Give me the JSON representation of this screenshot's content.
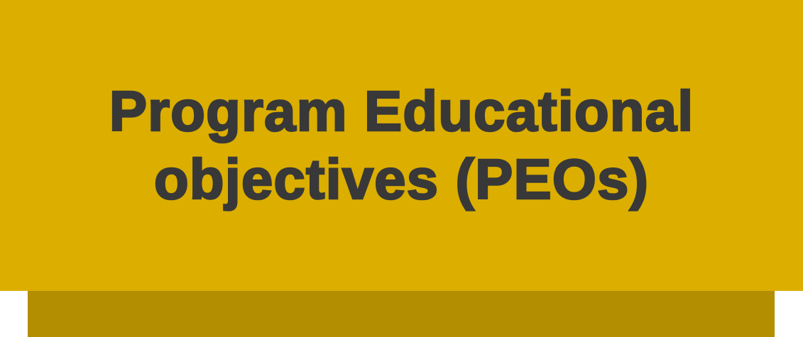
{
  "banner": {
    "title_line1": "Program Educational",
    "title_line2": "objectives (PEOs)",
    "background_color": "#dbae00",
    "text_color": "#383838"
  },
  "shadow_bar": {
    "color": "#b38e00"
  }
}
